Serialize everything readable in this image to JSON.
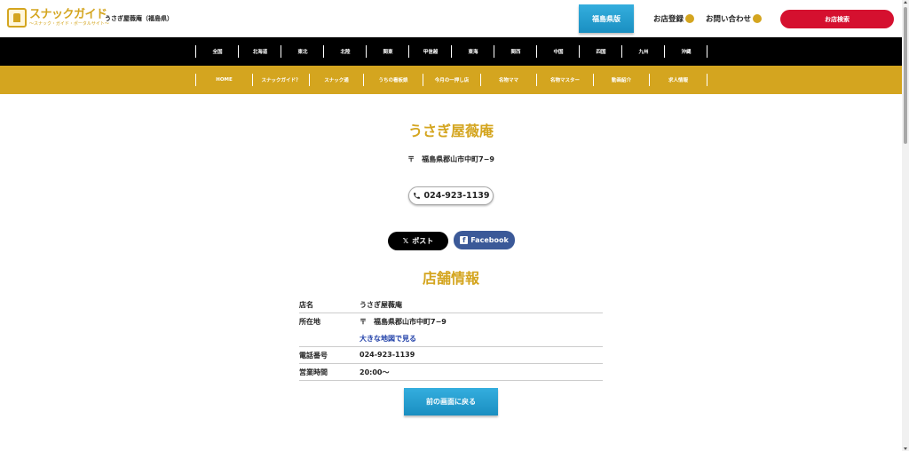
{
  "header": {
    "logo_title": "スナックガイド",
    "logo_sub": "～スナック・ガイド・ポータルサイト～",
    "store_label": "うさぎ屋薇庵（福島県）",
    "region_button": "福島県版",
    "register_label": "お店登録",
    "contact_label": "お問い合わせ",
    "search_button": "お店検索"
  },
  "region_nav": {
    "items": [
      "全国",
      "北海道",
      "東北",
      "北陸",
      "関東",
      "甲信越",
      "東海",
      "関西",
      "中国",
      "四国",
      "九州",
      "沖縄"
    ]
  },
  "menu_nav": {
    "items": [
      "HOME",
      "スナックガイド？",
      "スナック通",
      "うちの看板娘",
      "今月の一押し店",
      "名物ママ",
      "名物マスター",
      "動画紹介",
      "求人情報"
    ]
  },
  "store": {
    "name": "うさぎ屋薇庵",
    "address": "〒　福島県郡山市中町7−9",
    "phone": "024-923-1139"
  },
  "social": {
    "x_label": "ポスト",
    "fb_label": "Facebook"
  },
  "info": {
    "section_title": "店舗情報",
    "rows": [
      {
        "key": "店名",
        "value": "うさぎ屋薇庵"
      },
      {
        "key": "所在地",
        "value": "〒　福島県郡山市中町7−9",
        "link": "大きな地図で見る"
      },
      {
        "key": "電話番号",
        "value": "024-923-1139"
      },
      {
        "key": "営業時間",
        "value": "20:00〜"
      }
    ]
  },
  "back_button": "前の画面に戻る",
  "colors": {
    "gold": "#d4a51f",
    "red": "#d5102f",
    "blue": "#1a8fc1",
    "facebook": "#3b5998"
  }
}
